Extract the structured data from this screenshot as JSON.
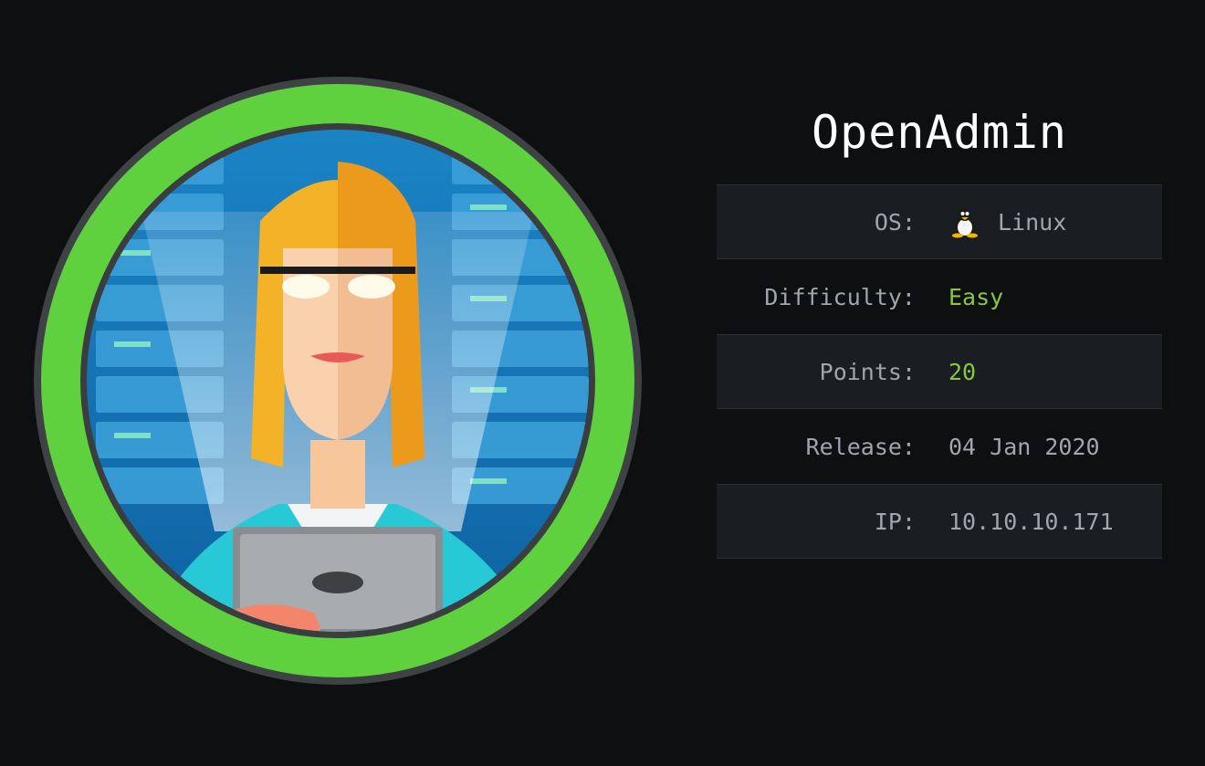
{
  "machine": {
    "name": "OpenAdmin",
    "avatar_icon": "server-admin-avatar-icon",
    "ring_color": "#5fd13e"
  },
  "info": {
    "os_label": "OS:",
    "os_value": "Linux",
    "os_icon": "linux-tux-icon",
    "difficulty_label": "Difficulty:",
    "difficulty_value": "Easy",
    "points_label": "Points:",
    "points_value": "20",
    "release_label": "Release:",
    "release_value": "04 Jan 2020",
    "ip_label": "IP:",
    "ip_value": "10.10.10.171"
  },
  "colors": {
    "background": "#0e0f11",
    "accent_green": "#8ac73e",
    "text_muted": "#9fa6ad",
    "row_shade": "#1a1d22"
  }
}
